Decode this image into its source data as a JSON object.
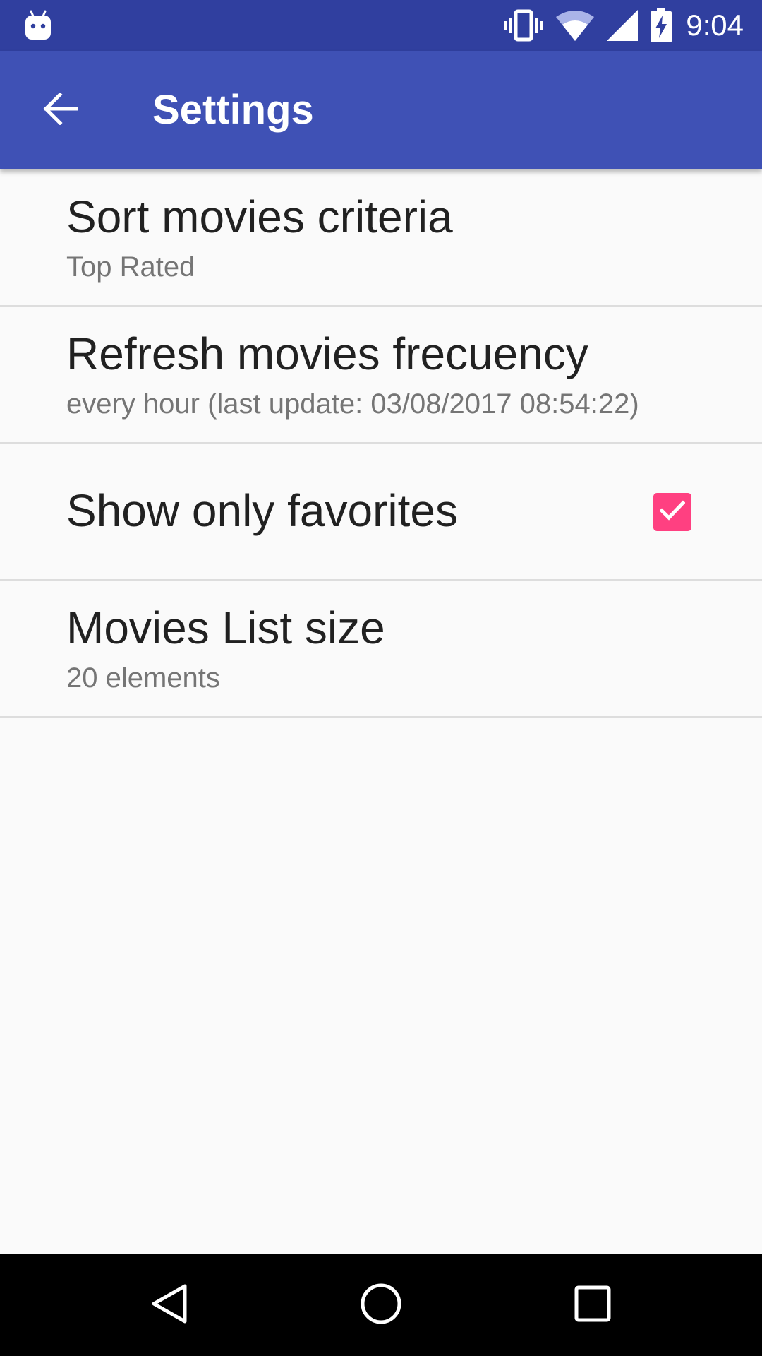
{
  "status_bar": {
    "time": "9:04",
    "icons": [
      "android-icon",
      "vibrate-icon",
      "wifi-icon",
      "cell-signal-icon",
      "battery-charging-icon"
    ]
  },
  "app_bar": {
    "title": "Settings",
    "back_icon": "arrow-back-icon"
  },
  "preferences": [
    {
      "title": "Sort movies criteria",
      "summary": "Top Rated"
    },
    {
      "title": "Refresh movies frecuency",
      "summary": "every hour (last update: 03/08/2017 08:54:22)"
    },
    {
      "title": "Show only favorites",
      "checked": true
    },
    {
      "title": "Movies List size",
      "summary": "20 elements"
    }
  ],
  "nav_bar": {
    "icons": [
      "back-triangle-icon",
      "home-circle-icon",
      "recents-square-icon"
    ]
  },
  "colors": {
    "status_bar": "#303f9f",
    "app_bar": "#3f51b5",
    "accent": "#ff4081",
    "background": "#fafafa"
  }
}
